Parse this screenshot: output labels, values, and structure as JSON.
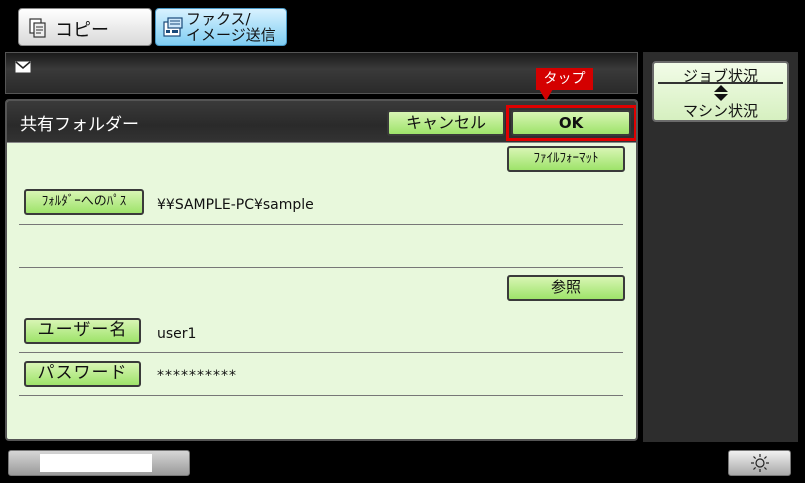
{
  "tabs": {
    "copy_label": "コピー",
    "fax_label_line1": "ファクス/",
    "fax_label_line2": "イメージ送信"
  },
  "status_panel": {
    "line1": "ジョブ状況",
    "arrows": "▲▼",
    "line2": "マシン状況"
  },
  "dialog": {
    "title": "共有フォルダー",
    "cancel_label": "キャンセル",
    "ok_label": "OK",
    "file_format_label": "ﾌｧｲﾙﾌｫｰﾏｯﾄ",
    "folder_path_label": "ﾌｫﾙﾀﾞｰへのﾊﾟｽ",
    "folder_path_value": "¥¥SAMPLE-PC¥sample",
    "browse_label": "参照",
    "user_name_label": "ユーザー名",
    "user_name_value": "user1",
    "password_label": "パスワード",
    "password_value": "**********"
  },
  "callout": {
    "text": "タップ"
  },
  "icons": {
    "mail": "mail-icon",
    "copy": "copy-icon",
    "fax": "fax-icon",
    "brightness": "sun-icon"
  },
  "colors": {
    "button_green": "#9ee36a",
    "dialog_bg": "#e8f8dc",
    "highlight_red": "#e00000",
    "tab_active_blue": "#7fcdf2"
  }
}
